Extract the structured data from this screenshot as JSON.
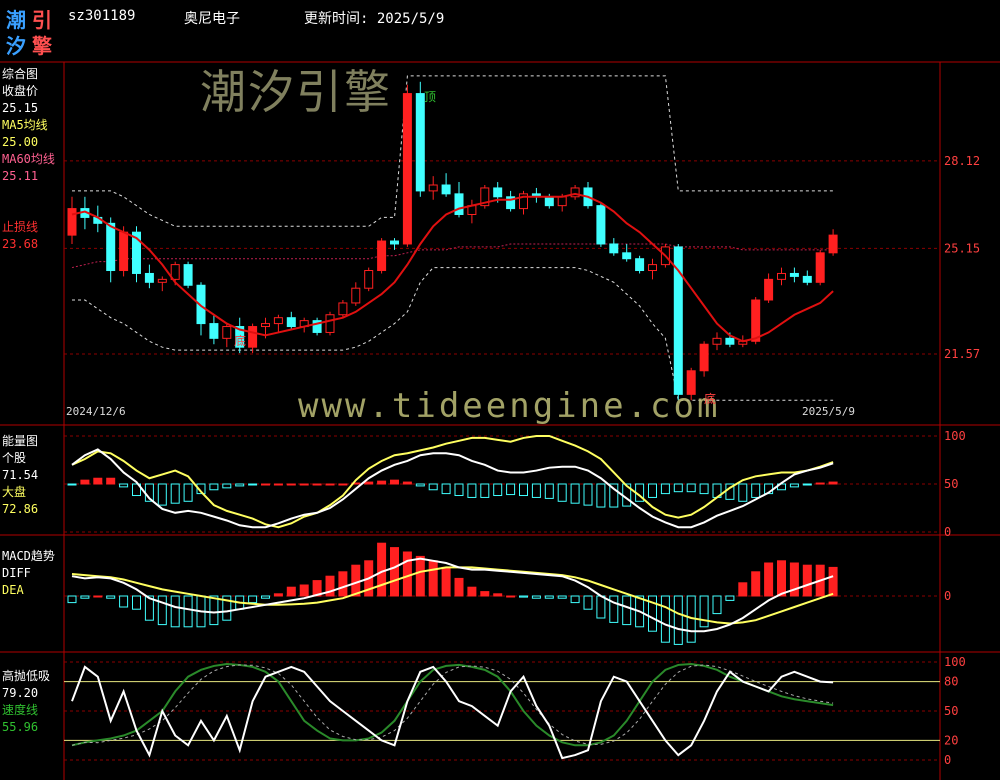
{
  "header": {
    "logo_chars": [
      "潮",
      "引",
      "汐",
      "擎"
    ],
    "code": "sz301189",
    "name": "奥尼电子",
    "update_label": "更新时间: 2025/5/9"
  },
  "watermarks": {
    "brand": "潮汐引擎",
    "url": "www.tideengine.com"
  },
  "colors": {
    "up": "#ff2020",
    "down": "#40ffff",
    "ma5": "#ffff60",
    "ma60": "#ff6090",
    "stop": "#ff2020",
    "grid": "#8b0000",
    "axis": "#b00000",
    "white": "#ffffff",
    "green": "#2a8a2a"
  },
  "panels": {
    "main": {
      "title": "综合图",
      "close_label": "收盘价",
      "close_value": "25.15",
      "ma5_label": "MA5均线",
      "ma5_value": "25.00",
      "ma60_label": "MA60均线",
      "ma60_value": "25.11",
      "stop_label": "止损线",
      "stop_value": "23.68",
      "top_marker": "顶",
      "bottom_marker_1": "底",
      "bottom_marker_2": "底",
      "start_date": "2024/12/6",
      "end_date": "2025/5/9"
    },
    "energy": {
      "title": "能量图",
      "stock_label": "个股",
      "stock_value": "71.54",
      "market_label": "大盘",
      "market_value": "72.86"
    },
    "macd": {
      "title": "MACD趋势",
      "diff_label": "DIFF",
      "dea_label": "DEA"
    },
    "hl": {
      "title": "高抛低吸",
      "value": "79.20",
      "speed_label": "速度线",
      "speed_value": "55.96"
    }
  },
  "chart_data": [
    {
      "type": "candlestick",
      "title": "综合图",
      "y_ticks": [
        "28.12",
        "25.15",
        "21.57"
      ],
      "ylim": [
        19.5,
        31.2
      ],
      "x_range": [
        "2024/12/6",
        "2025/5/9"
      ],
      "candles": [
        [
          25.6,
          26.9,
          25.3,
          26.5
        ],
        [
          26.5,
          26.9,
          25.8,
          26.2
        ],
        [
          26.2,
          26.6,
          25.7,
          26.0
        ],
        [
          26.0,
          26.2,
          24.0,
          24.4
        ],
        [
          24.4,
          25.9,
          24.2,
          25.7
        ],
        [
          25.7,
          25.9,
          24.0,
          24.3
        ],
        [
          24.3,
          24.6,
          23.8,
          24.0
        ],
        [
          24.0,
          24.2,
          23.7,
          24.1
        ],
        [
          24.1,
          24.7,
          23.9,
          24.6
        ],
        [
          24.6,
          24.7,
          23.8,
          23.9
        ],
        [
          23.9,
          24.0,
          22.2,
          22.6
        ],
        [
          22.6,
          22.9,
          21.9,
          22.1
        ],
        [
          22.1,
          22.6,
          21.8,
          22.5
        ],
        [
          22.5,
          22.8,
          21.6,
          21.8
        ],
        [
          21.8,
          22.6,
          21.6,
          22.5
        ],
        [
          22.5,
          22.8,
          22.1,
          22.6
        ],
        [
          22.6,
          22.9,
          22.3,
          22.8
        ],
        [
          22.8,
          23.0,
          22.4,
          22.5
        ],
        [
          22.5,
          22.8,
          22.3,
          22.7
        ],
        [
          22.7,
          22.8,
          22.2,
          22.3
        ],
        [
          22.3,
          23.0,
          22.2,
          22.9
        ],
        [
          22.9,
          23.4,
          22.8,
          23.3
        ],
        [
          23.3,
          24.0,
          23.2,
          23.8
        ],
        [
          23.8,
          24.5,
          23.7,
          24.4
        ],
        [
          24.4,
          25.5,
          24.3,
          25.4
        ],
        [
          25.4,
          25.5,
          25.1,
          25.3
        ],
        [
          25.3,
          30.7,
          25.2,
          30.4
        ],
        [
          30.4,
          30.8,
          26.9,
          27.1
        ],
        [
          27.1,
          27.6,
          26.8,
          27.3
        ],
        [
          27.3,
          27.7,
          26.9,
          27.0
        ],
        [
          27.0,
          27.4,
          26.2,
          26.3
        ],
        [
          26.3,
          26.8,
          26.0,
          26.6
        ],
        [
          26.6,
          27.3,
          26.5,
          27.2
        ],
        [
          27.2,
          27.4,
          26.7,
          26.9
        ],
        [
          26.9,
          27.1,
          26.4,
          26.5
        ],
        [
          26.5,
          27.1,
          26.3,
          27.0
        ],
        [
          27.0,
          27.2,
          26.7,
          26.9
        ],
        [
          26.9,
          27.0,
          26.5,
          26.6
        ],
        [
          26.6,
          27.0,
          26.4,
          26.9
        ],
        [
          26.9,
          27.3,
          26.8,
          27.2
        ],
        [
          27.2,
          27.4,
          26.5,
          26.6
        ],
        [
          26.6,
          26.7,
          25.2,
          25.3
        ],
        [
          25.3,
          25.5,
          24.9,
          25.0
        ],
        [
          25.0,
          25.3,
          24.7,
          24.8
        ],
        [
          24.8,
          24.9,
          24.3,
          24.4
        ],
        [
          24.4,
          24.8,
          24.1,
          24.6
        ],
        [
          24.6,
          25.3,
          24.5,
          25.2
        ],
        [
          25.2,
          25.3,
          20.0,
          20.2
        ],
        [
          20.2,
          21.1,
          20.0,
          21.0
        ],
        [
          21.0,
          22.0,
          20.8,
          21.9
        ],
        [
          21.9,
          22.3,
          21.7,
          22.1
        ],
        [
          22.1,
          22.3,
          21.8,
          21.9
        ],
        [
          21.9,
          22.2,
          21.8,
          22.0
        ],
        [
          22.0,
          23.5,
          21.9,
          23.4
        ],
        [
          23.4,
          24.3,
          23.3,
          24.1
        ],
        [
          24.1,
          24.5,
          23.9,
          24.3
        ],
        [
          24.3,
          24.5,
          24.0,
          24.2
        ],
        [
          24.2,
          24.4,
          23.9,
          24.0
        ],
        [
          24.0,
          25.1,
          23.9,
          25.0
        ],
        [
          25.0,
          25.8,
          24.9,
          25.6
        ]
      ],
      "ma5": [
        25.8,
        25.5,
        25.3,
        25.1,
        25.2,
        25.0,
        24.7,
        24.3,
        24.0,
        23.6,
        23.2,
        22.8,
        22.6,
        22.4,
        22.3,
        22.3,
        22.4,
        22.5,
        22.6,
        22.6,
        22.7,
        22.8,
        23.0,
        23.3,
        23.7,
        24.2,
        25.6,
        26.4,
        27.0,
        27.5,
        27.8,
        27.7,
        27.3,
        27.0,
        26.9,
        26.9,
        26.9,
        26.8,
        26.8,
        26.9,
        26.9,
        26.6,
        26.2,
        25.8,
        25.3,
        24.9,
        24.6,
        23.8,
        23.0,
        22.4,
        21.7,
        21.3,
        21.4,
        21.8,
        22.2,
        22.7,
        23.2,
        23.5,
        23.8,
        24.2
      ],
      "ma60": [
        24.5,
        24.6,
        24.7,
        24.7,
        24.8,
        24.8,
        24.8,
        24.8,
        24.8,
        24.8,
        24.8,
        24.8,
        24.8,
        24.8,
        24.8,
        24.8,
        24.8,
        24.8,
        24.8,
        24.8,
        24.8,
        24.8,
        24.8,
        24.8,
        24.9,
        24.9,
        25.0,
        25.1,
        25.1,
        25.1,
        25.2,
        25.2,
        25.2,
        25.2,
        25.3,
        25.3,
        25.3,
        25.3,
        25.3,
        25.3,
        25.3,
        25.3,
        25.3,
        25.3,
        25.3,
        25.3,
        25.3,
        25.2,
        25.2,
        25.2,
        25.2,
        25.2,
        25.1,
        25.1,
        25.1,
        25.1,
        25.1,
        25.1,
        25.1,
        25.1
      ],
      "stop_line": [
        26.3,
        26.4,
        26.2,
        25.9,
        25.7,
        25.5,
        25.1,
        24.6,
        24.0,
        23.6,
        23.2,
        22.9,
        22.6,
        22.4,
        22.3,
        22.2,
        22.3,
        22.4,
        22.5,
        22.6,
        22.7,
        22.8,
        23.0,
        23.3,
        23.6,
        24.0,
        24.6,
        25.3,
        25.9,
        26.3,
        26.5,
        26.6,
        26.7,
        26.8,
        26.8,
        26.9,
        26.9,
        26.9,
        26.9,
        27.0,
        26.9,
        26.7,
        26.4,
        26.0,
        25.7,
        25.3,
        24.9,
        24.4,
        23.8,
        23.2,
        22.6,
        22.2,
        22.0,
        22.1,
        22.3,
        22.6,
        22.9,
        23.1,
        23.3,
        23.7
      ],
      "upper_band": [
        27.1,
        27.1,
        27.1,
        27.1,
        26.9,
        26.6,
        26.3,
        26.1,
        25.9,
        25.9,
        25.9,
        25.9,
        25.9,
        25.9,
        25.9,
        25.9,
        25.9,
        25.9,
        25.9,
        25.9,
        25.9,
        25.9,
        25.9,
        25.9,
        26.2,
        26.2,
        31.0,
        31.0,
        31.0,
        31.0,
        31.0,
        31.0,
        31.0,
        31.0,
        31.0,
        31.0,
        31.0,
        31.0,
        31.0,
        31.0,
        31.0,
        31.0,
        31.0,
        31.0,
        31.0,
        31.0,
        31.0,
        27.1,
        27.1,
        27.1,
        27.1,
        27.1,
        27.1,
        27.1,
        27.1,
        27.1,
        27.1,
        27.1,
        27.1,
        27.1
      ],
      "lower_band": [
        23.4,
        23.4,
        23.1,
        22.8,
        22.6,
        22.3,
        22.0,
        21.8,
        21.7,
        21.7,
        21.7,
        21.7,
        21.7,
        21.7,
        21.7,
        21.7,
        21.7,
        21.7,
        21.7,
        21.7,
        21.7,
        21.7,
        21.8,
        22.0,
        22.3,
        22.6,
        23.0,
        24.0,
        24.5,
        24.5,
        24.5,
        24.5,
        24.5,
        24.5,
        24.5,
        24.5,
        24.5,
        24.5,
        24.5,
        24.5,
        24.4,
        24.2,
        24.0,
        23.6,
        23.2,
        22.6,
        22.1,
        20.0,
        20.0,
        20.0,
        20.0,
        20.0,
        20.0,
        20.0,
        20.0,
        20.0,
        20.0,
        20.0,
        20.0,
        20.0
      ],
      "markers": [
        {
          "index": 26,
          "label": "顶"
        },
        {
          "index": 13,
          "label": "底"
        },
        {
          "index": 47,
          "label": "底"
        }
      ]
    },
    {
      "type": "line",
      "title": "能量图",
      "y_ticks": [
        "100",
        "50",
        "0"
      ],
      "ylim": [
        0,
        100
      ],
      "series": [
        {
          "name": "个股",
          "values": [
            70,
            80,
            86,
            76,
            62,
            52,
            35,
            24,
            20,
            22,
            20,
            16,
            12,
            7,
            5,
            5,
            9,
            14,
            18,
            20,
            25,
            34,
            45,
            56,
            64,
            70,
            74,
            80,
            82,
            82,
            80,
            74,
            70,
            64,
            62,
            62,
            64,
            67,
            68,
            68,
            64,
            56,
            45,
            35,
            25,
            16,
            10,
            5,
            5,
            10,
            17,
            22,
            27,
            34,
            41,
            51,
            60,
            64,
            67,
            71.5
          ]
        },
        {
          "name": "大盘",
          "values": [
            70,
            76,
            84,
            82,
            74,
            64,
            56,
            60,
            64,
            58,
            42,
            28,
            22,
            18,
            14,
            8,
            5,
            9,
            16,
            20,
            28,
            38,
            54,
            66,
            74,
            80,
            82,
            85,
            88,
            92,
            95,
            98,
            98,
            96,
            94,
            98,
            100,
            100,
            95,
            90,
            84,
            76,
            62,
            48,
            38,
            26,
            18,
            15,
            18,
            26,
            36,
            46,
            54,
            58,
            60,
            62,
            62,
            64,
            68,
            72.9
          ]
        }
      ],
      "bars": [
        -1,
        4,
        6,
        6,
        -3,
        -12,
        -18,
        -22,
        -20,
        -18,
        -10,
        -6,
        -4,
        -2,
        -1,
        0,
        0,
        0,
        0,
        0,
        0,
        0,
        1,
        2,
        3,
        4,
        2,
        -2,
        -6,
        -10,
        -12,
        -14,
        -14,
        -12,
        -11,
        -12,
        -14,
        -15,
        -18,
        -20,
        -22,
        -24,
        -24,
        -23,
        -18,
        -14,
        -10,
        -8,
        -8,
        -10,
        -14,
        -16,
        -18,
        -14,
        -10,
        -6,
        -3,
        -1,
        1,
        2
      ]
    },
    {
      "type": "bar",
      "title": "MACD趋势",
      "y_ticks": [
        "0"
      ],
      "series": [
        {
          "name": "DIFF",
          "values": [
            0.9,
            0.8,
            0.85,
            0.8,
            0.6,
            0.3,
            -0.1,
            -0.3,
            -0.5,
            -0.6,
            -0.7,
            -0.75,
            -0.7,
            -0.6,
            -0.5,
            -0.4,
            -0.3,
            -0.2,
            -0.1,
            0.05,
            0.2,
            0.4,
            0.6,
            0.8,
            1.1,
            1.3,
            1.6,
            1.7,
            1.6,
            1.5,
            1.3,
            1.2,
            1.2,
            1.15,
            1.1,
            1.05,
            1.0,
            0.95,
            0.9,
            0.7,
            0.4,
            0.0,
            -0.3,
            -0.5,
            -0.7,
            -1.0,
            -1.3,
            -1.5,
            -1.6,
            -1.6,
            -1.5,
            -1.3,
            -1.0,
            -0.6,
            -0.2,
            0.1,
            0.3,
            0.5,
            0.7,
            0.9
          ]
        },
        {
          "name": "DEA",
          "values": [
            1.0,
            0.95,
            0.9,
            0.85,
            0.75,
            0.6,
            0.45,
            0.3,
            0.2,
            0.1,
            0.0,
            -0.1,
            -0.2,
            -0.3,
            -0.35,
            -0.4,
            -0.4,
            -0.38,
            -0.35,
            -0.3,
            -0.2,
            -0.1,
            0.1,
            0.3,
            0.5,
            0.7,
            0.9,
            1.1,
            1.2,
            1.3,
            1.3,
            1.3,
            1.25,
            1.2,
            1.15,
            1.1,
            1.05,
            1.0,
            0.95,
            0.85,
            0.7,
            0.5,
            0.3,
            0.1,
            -0.1,
            -0.3,
            -0.5,
            -0.8,
            -1.0,
            -1.1,
            -1.2,
            -1.25,
            -1.2,
            -1.1,
            -0.9,
            -0.7,
            -0.5,
            -0.3,
            -0.1,
            0.1
          ]
        }
      ],
      "bars": [
        -0.3,
        -0.1,
        0.0,
        -0.1,
        -0.5,
        -0.6,
        -1.1,
        -1.3,
        -1.4,
        -1.4,
        -1.4,
        -1.3,
        -1.1,
        -0.6,
        -0.3,
        -0.1,
        0.1,
        0.4,
        0.5,
        0.7,
        0.9,
        1.1,
        1.4,
        1.6,
        2.4,
        2.2,
        2.0,
        1.8,
        1.6,
        1.3,
        0.8,
        0.4,
        0.2,
        0.1,
        0.0,
        -0.05,
        -0.1,
        -0.1,
        -0.1,
        -0.3,
        -0.6,
        -1.0,
        -1.2,
        -1.3,
        -1.4,
        -1.6,
        -2.1,
        -2.2,
        -2.1,
        -1.4,
        -0.8,
        -0.2,
        0.6,
        1.1,
        1.5,
        1.6,
        1.5,
        1.4,
        1.4,
        1.3
      ]
    },
    {
      "type": "line",
      "title": "高抛低吸",
      "y_ticks": [
        "100",
        "80",
        "50",
        "20",
        "0"
      ],
      "ylim": [
        0,
        100
      ],
      "series": [
        {
          "name": "高抛低吸",
          "values": [
            60,
            95,
            85,
            40,
            70,
            30,
            5,
            50,
            25,
            15,
            40,
            20,
            45,
            10,
            60,
            85,
            90,
            95,
            90,
            75,
            60,
            50,
            40,
            30,
            20,
            15,
            60,
            90,
            95,
            80,
            60,
            55,
            45,
            35,
            70,
            85,
            55,
            35,
            2,
            5,
            10,
            60,
            85,
            80,
            60,
            40,
            20,
            5,
            15,
            40,
            70,
            90,
            80,
            75,
            70,
            85,
            90,
            85,
            80,
            79.2
          ]
        },
        {
          "name": "速度线",
          "values": [
            15,
            18,
            20,
            22,
            25,
            30,
            40,
            50,
            70,
            85,
            92,
            96,
            98,
            97,
            95,
            90,
            80,
            60,
            40,
            30,
            22,
            20,
            20,
            22,
            28,
            40,
            60,
            80,
            92,
            96,
            97,
            95,
            92,
            85,
            70,
            50,
            35,
            25,
            18,
            15,
            15,
            18,
            25,
            40,
            60,
            80,
            92,
            97,
            98,
            96,
            92,
            85,
            80,
            75,
            70,
            65,
            62,
            60,
            58,
            56
          ]
        }
      ]
    }
  ]
}
